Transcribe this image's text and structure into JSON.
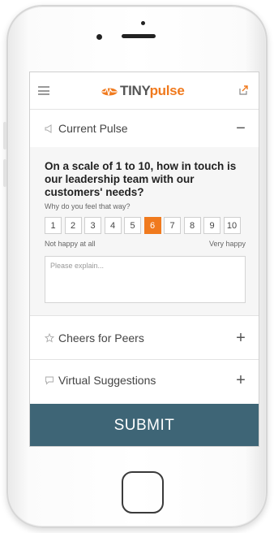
{
  "app": {
    "logo_prefix": "TINY",
    "logo_suffix": "pulse"
  },
  "sections": {
    "current_pulse": {
      "title": "Current Pulse",
      "toggle": "−"
    },
    "cheers": {
      "title": "Cheers for Peers",
      "toggle": "+"
    },
    "suggestions": {
      "title": "Virtual Suggestions",
      "toggle": "+"
    }
  },
  "pulse": {
    "question": "On a scale of 1 to 10, how in touch is our leadership team with our customers' needs?",
    "prompt": "Why do you feel that way?",
    "scale": [
      "1",
      "2",
      "3",
      "4",
      "5",
      "6",
      "7",
      "8",
      "9",
      "10"
    ],
    "selected": "6",
    "low_label": "Not happy at all",
    "high_label": "Very happy",
    "explain_placeholder": "Please explain..."
  },
  "submit_label": "SUBMIT",
  "colors": {
    "accent": "#f07a1e",
    "submit_bg": "#3e6576"
  },
  "icons": {
    "menu": "hamburger-icon",
    "logo": "tiny-pulse-logo",
    "share": "share-icon",
    "current_pulse": "megaphone-icon",
    "cheers": "star-icon",
    "suggestions": "speech-bubble-icon"
  }
}
